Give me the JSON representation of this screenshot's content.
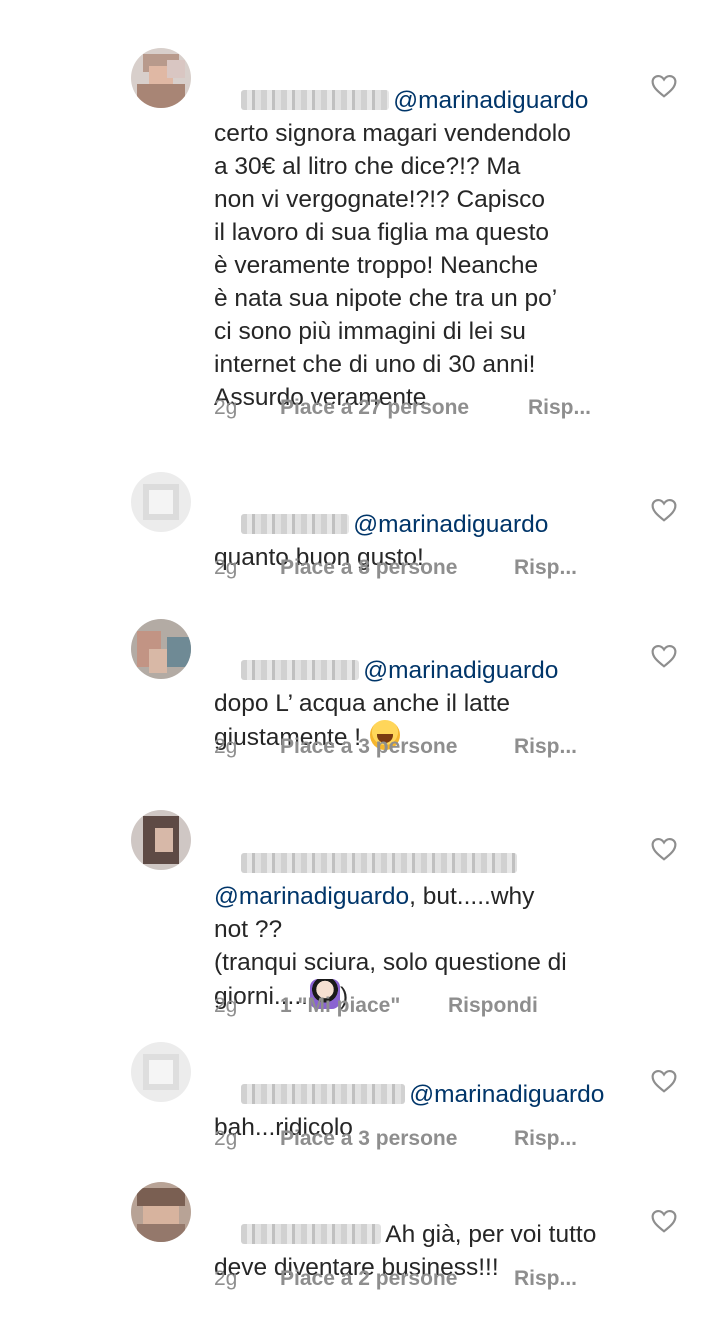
{
  "comments": [
    {
      "mention": "@marinadiguardo",
      "text_after_mention": "",
      "text": "certo signora magari vendendolo\na 30€ al litro che dice?!? Ma\nnon vi vergognate!?!? Capisco\nil lavoro di sua figlia ma questo\nè veramente troppo! Neanche\nè nata sua nipote che tra un po’\nci sono più immagini di lei su\ninternet che di uno di 30 anni!\nAssurdo veramente",
      "time": "2g",
      "likes": "Piace a 27 persone",
      "reply": "Risp..."
    },
    {
      "mention": "@marinadiguardo",
      "text": "quanto buon gusto!",
      "time": "2g",
      "likes": "Piace a 8 persone",
      "reply": "Risp..."
    },
    {
      "mention": "@marinadiguardo",
      "text": "dopo L’ acqua anche il latte\ngiustamente ! ",
      "emoji": "face-with-tears-of-joy",
      "time": "2g",
      "likes": "Piace a 3 persone",
      "reply": "Risp..."
    },
    {
      "mention": "@marinadiguardo",
      "text_after_mention": ", but.....why",
      "text": "not ??\n(tranqui sciura, solo questione di\ngiorni.....",
      "emoji": "woman-facepalming",
      "text_end": ")",
      "time": "2g",
      "likes": "1 \"Mi piace\"",
      "reply": "Rispondi"
    },
    {
      "mention": "@marinadiguardo",
      "text": "bah...ridicolo",
      "time": "2g",
      "likes": "Piace a 3 persone",
      "reply": "Risp..."
    },
    {
      "mention": "",
      "first_line": "Ah già, per voi tutto",
      "text": "deve diventare business!!!",
      "time": "2g",
      "likes": "Piace a 2 persone",
      "reply": "Risp..."
    }
  ],
  "icons": {
    "like": "heart-outline-icon"
  },
  "colors": {
    "text": "#262626",
    "mention": "#003569",
    "meta": "#8e8e8e",
    "heart": "#8e8e8e"
  }
}
